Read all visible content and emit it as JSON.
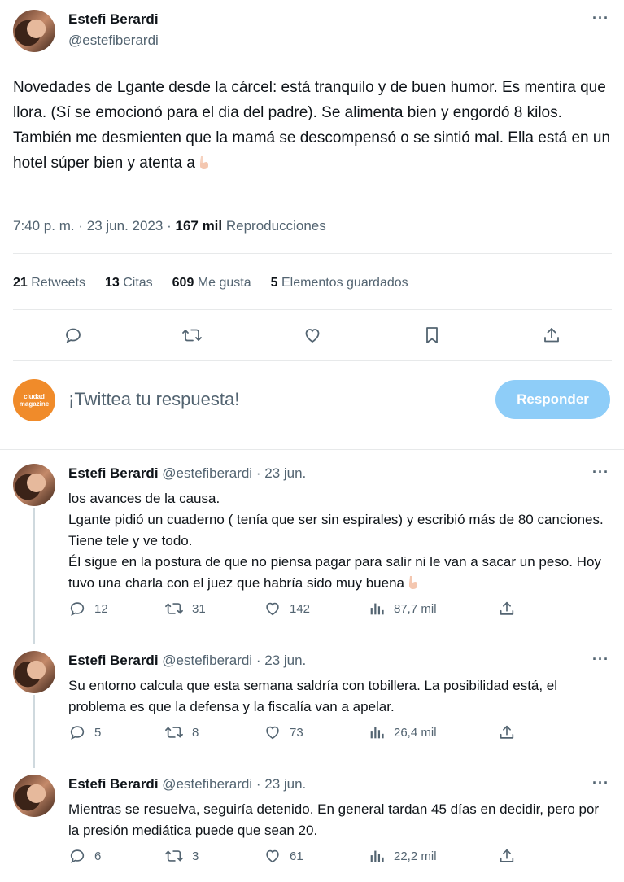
{
  "main_tweet": {
    "author_name": "Estefi Berardi",
    "author_handle": "@estefiberardi",
    "more_icon": "more-icon",
    "paragraph1": "Novedades de Lgante desde la cárcel: está tranquilo y de buen humor. Es mentira que llora. (Sí se emocionó para el dia del padre). Se alimenta bien y engordó 8 kilos.",
    "paragraph2": "También me desmienten que la mamá se descompensó o se sintió mal. Ella está en un hotel súper bien y atenta a",
    "time": "7:40 p. m.",
    "date": "23 jun. 2023",
    "views_count": "167 mil",
    "views_label": "Reproducciones",
    "sep": "·"
  },
  "stats": {
    "retweets_count": "21",
    "retweets_label": "Retweets",
    "quotes_count": "13",
    "quotes_label": "Citas",
    "likes_count": "609",
    "likes_label": "Me gusta",
    "bookmarks_count": "5",
    "bookmarks_label": "Elementos guardados"
  },
  "compose": {
    "logo_line1": "ciudad",
    "logo_line2": "magazine",
    "prompt": "¡Twittea tu respuesta!",
    "button_label": "Responder"
  },
  "replies": [
    {
      "author_name": "Estefi Berardi",
      "author_handle": "@estefiberardi",
      "date": "23 jun.",
      "lines": [
        "los avances de la causa.",
        "Lgante pidió un cuaderno ( tenía que ser sin espirales) y escribió más de 80 canciones. Tiene tele y ve todo.",
        "Él sigue en la postura de que no piensa pagar para salir ni le van a sacar un peso. Hoy tuvo una charla con el juez que habría sido muy buena"
      ],
      "replies": "12",
      "retweets": "31",
      "likes": "142",
      "views": "87,7 mil"
    },
    {
      "author_name": "Estefi Berardi",
      "author_handle": "@estefiberardi",
      "date": "23 jun.",
      "lines": [
        "Su entorno calcula que esta semana saldría con tobillera. La posibilidad está, el problema es que la defensa y la fiscalía van a apelar."
      ],
      "replies": "5",
      "retweets": "8",
      "likes": "73",
      "views": "26,4 mil"
    },
    {
      "author_name": "Estefi Berardi",
      "author_handle": "@estefiberardi",
      "date": "23 jun.",
      "lines": [
        "Mientras se resuelva, seguiría detenido. En general tardan 45 días en decidir, pero por la presión mediática puede que sean 20."
      ],
      "replies": "6",
      "retweets": "3",
      "likes": "61",
      "views": "22,2 mil"
    }
  ],
  "colors": {
    "text": "#0f1419",
    "secondary": "#536471",
    "divider": "#e7e9ea",
    "button_disabled": "#8ecdf8",
    "brand": "#f08b2a"
  }
}
